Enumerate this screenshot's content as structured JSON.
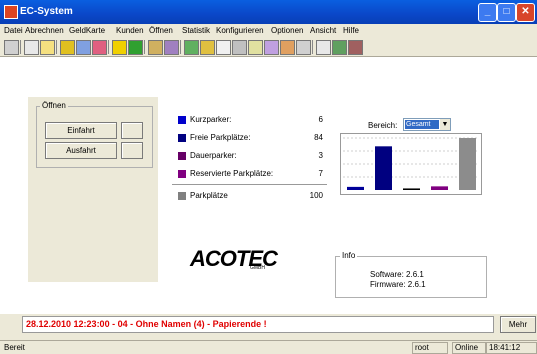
{
  "window": {
    "title": "EC-System"
  },
  "menu": [
    "Datei",
    "Abrechnen",
    "GeldKarte",
    "Kunden",
    "Öffnen",
    "Statistik",
    "Konfigurieren",
    "Optionen",
    "Ansicht",
    "Hilfe"
  ],
  "left_panel": {
    "group_title": "Öffnen",
    "entry_button": "Einfahrt",
    "exit_button": "Ausfahrt"
  },
  "stats": [
    {
      "label": "Kurzparker:",
      "value": "6",
      "color": "#0000cc"
    },
    {
      "label": "Freie Parkplätze:",
      "value": "84",
      "color": "#000080"
    },
    {
      "label": "Dauerparker:",
      "value": "3",
      "color": "#660066"
    },
    {
      "label": "Reservierte Parkplätze:",
      "value": "7",
      "color": "#800080"
    }
  ],
  "total": {
    "label": "Parkplätze",
    "value": "100",
    "color": "#808080"
  },
  "bereich": {
    "label": "Bereich:",
    "selected": "Gesamt"
  },
  "chart_data": {
    "type": "bar",
    "categories": [
      "Kurzparker",
      "Freie Parkplätze",
      "Dauerparker",
      "Reservierte Parkplätze",
      "Parkplätze"
    ],
    "values": [
      6,
      84,
      3,
      7,
      100
    ],
    "colors": [
      "#000099",
      "#000080",
      "#000000",
      "#800080",
      "#8c8c8c"
    ],
    "ylim": [
      0,
      100
    ]
  },
  "logo": {
    "text": "ACOTEC",
    "sub": "GMBH"
  },
  "info": {
    "title": "Info",
    "software": "Software: 2.6.1",
    "firmware": "Firmware: 2.6.1"
  },
  "status_message": "28.12.2010 12:23:00 - 04 - Ohne Namen (4) - Papierende !",
  "more_button": "Mehr",
  "statusbar": {
    "ready": "Bereit",
    "user": "root",
    "mode": "Online",
    "time": "18:41:12"
  }
}
